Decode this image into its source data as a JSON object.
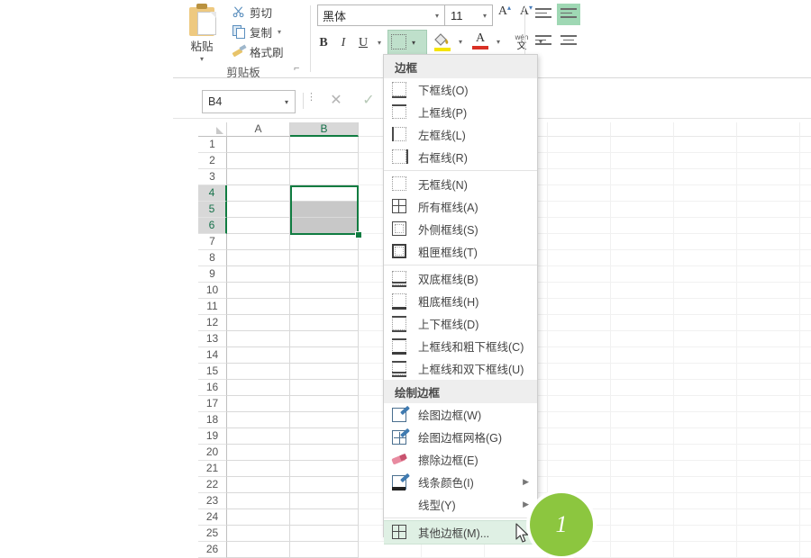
{
  "app": "Excel",
  "ribbon": {
    "clipboard": {
      "group_label": "剪贴板",
      "paste_label": "粘贴",
      "paste_caret": "▾",
      "cut_label": "剪切",
      "copy_label": "复制",
      "copy_caret": "▾",
      "format_painter_label": "格式刷",
      "launcher_glyph": "⌐"
    },
    "font": {
      "font_name": "黑体",
      "font_name_caret": "▾",
      "font_size": "11",
      "font_size_caret": "▾",
      "grow_font": "A",
      "grow_font_sup": "▴",
      "shrink_font": "A",
      "shrink_font_sup": "▾",
      "bold": "B",
      "italic": "I",
      "underline": "U",
      "underline_caret": "▾",
      "border_caret": "▾",
      "fill_caret": "▾",
      "font_color_letter": "A",
      "font_color_caret": "▾",
      "phonetic_top": "wén",
      "phonetic_bottom": "文",
      "phonetic_caret": "▾"
    }
  },
  "formula_bar": {
    "name_box_value": "B4",
    "name_box_caret": "▾",
    "fx_dots": "⋮",
    "cancel": "✕",
    "confirm": "✓"
  },
  "grid": {
    "columns": [
      "A",
      "B"
    ],
    "selected_column": "B",
    "rows": [
      "1",
      "2",
      "3",
      "4",
      "5",
      "6",
      "7",
      "8",
      "9",
      "10",
      "11",
      "12",
      "13",
      "14",
      "15",
      "16",
      "17",
      "18",
      "19",
      "20",
      "21",
      "22",
      "23",
      "24",
      "25",
      "26"
    ],
    "selected_rows": [
      "4",
      "5",
      "6"
    ],
    "selection_range": "B4:B6",
    "active_cell": "B4",
    "selection_color": "#107c41"
  },
  "border_menu": {
    "section_borders_title": "边框",
    "borders": [
      {
        "label": "下框线(O)",
        "icon": "border-bottom-icon"
      },
      {
        "label": "上框线(P)",
        "icon": "border-top-icon"
      },
      {
        "label": "左框线(L)",
        "icon": "border-left-icon"
      },
      {
        "label": "右框线(R)",
        "icon": "border-right-icon"
      },
      {
        "label": "无框线(N)",
        "icon": "border-none-icon"
      },
      {
        "label": "所有框线(A)",
        "icon": "border-all-icon"
      },
      {
        "label": "外侧框线(S)",
        "icon": "border-outside-icon"
      },
      {
        "label": "粗匣框线(T)",
        "icon": "border-thick-box-icon"
      },
      {
        "label": "双底框线(B)",
        "icon": "border-double-bottom-icon"
      },
      {
        "label": "粗底框线(H)",
        "icon": "border-thick-bottom-icon"
      },
      {
        "label": "上下框线(D)",
        "icon": "border-top-and-bottom-icon"
      },
      {
        "label": "上框线和粗下框线(C)",
        "icon": "border-top-and-thick-bottom-icon"
      },
      {
        "label": "上框线和双下框线(U)",
        "icon": "border-top-and-double-bottom-icon"
      }
    ],
    "section_draw_title": "绘制边框",
    "draw": [
      {
        "label": "绘图边框(W)",
        "icon": "draw-border-icon",
        "arrow": ""
      },
      {
        "label": "绘图边框网格(G)",
        "icon": "draw-border-grid-icon",
        "arrow": ""
      },
      {
        "label": "擦除边框(E)",
        "icon": "erase-border-icon",
        "arrow": ""
      },
      {
        "label": "线条颜色(I)",
        "icon": "line-color-icon",
        "arrow": "▶"
      },
      {
        "label": "线型(Y)",
        "icon": "line-style-icon",
        "arrow": "▶"
      },
      {
        "label": "其他边框(M)...",
        "icon": "more-borders-icon",
        "arrow": ""
      }
    ],
    "active_item_label": "其他边框(M)...",
    "highlight_color": "#dff0e4"
  },
  "callout": {
    "step_number": "1",
    "badge_color": "#8cc63f"
  }
}
